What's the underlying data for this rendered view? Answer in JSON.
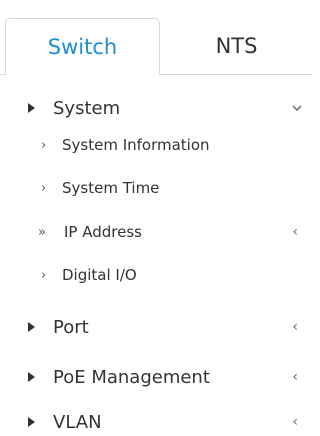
{
  "tabs": {
    "switch_label": "Switch",
    "nts_label": "NTS"
  },
  "menu": {
    "system": {
      "label": "System",
      "children": [
        {
          "label": "System Information",
          "marker": "›"
        },
        {
          "label": "System Time",
          "marker": "›"
        },
        {
          "label": "IP Address",
          "marker": "»"
        },
        {
          "label": "Digital I/O",
          "marker": "›"
        }
      ]
    },
    "port": {
      "label": "Port"
    },
    "poe": {
      "label": "PoE Management"
    },
    "vlan": {
      "label": "VLAN"
    }
  },
  "icons": {
    "expand": "caret-right-icon",
    "collapse": "chevron-down-icon",
    "submenu": "chevron-left-icon"
  },
  "colors": {
    "active_tab_text": "#1e8fd6",
    "text": "#333333",
    "border": "#d9d9d9"
  }
}
